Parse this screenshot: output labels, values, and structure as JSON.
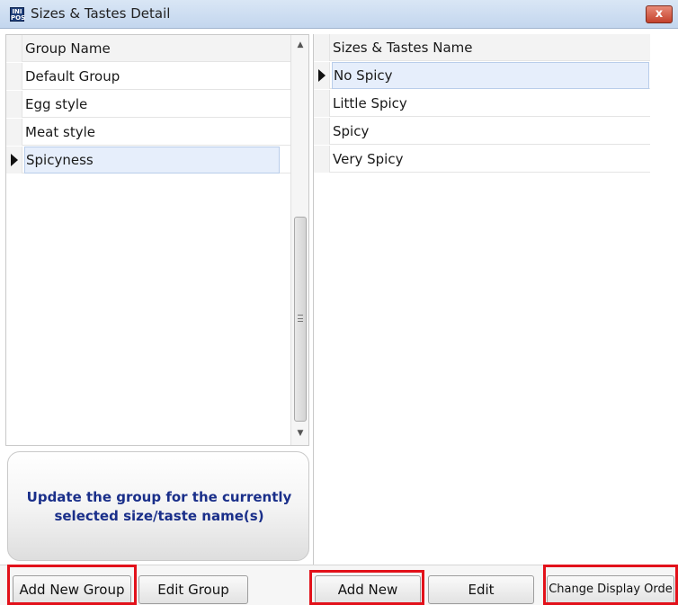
{
  "window": {
    "title": "Sizes & Tastes Detail",
    "icon_text": "INI POS",
    "close_symbol": "x"
  },
  "groups": {
    "header": "Group Name",
    "rows": [
      "Default Group",
      "Egg style",
      "Meat style",
      "Spicyness"
    ],
    "selected_index": 3
  },
  "items": {
    "header": "Sizes & Tastes Name",
    "rows": [
      "No Spicy",
      "Little Spicy",
      "Spicy",
      "Very Spicy"
    ],
    "selected_index": 0
  },
  "info_panel": {
    "line1": "Update the group for the currently",
    "line2": "selected size/taste name(s)"
  },
  "buttons": {
    "add_new_group": "Add New Group",
    "edit_group": "Edit Group",
    "add_new": "Add New",
    "edit": "Edit",
    "change_display_order": "Change Display Orde"
  },
  "colors": {
    "highlight": "#e2111a",
    "info_text": "#1a2f8a",
    "selected_row": "#e6eefb"
  }
}
